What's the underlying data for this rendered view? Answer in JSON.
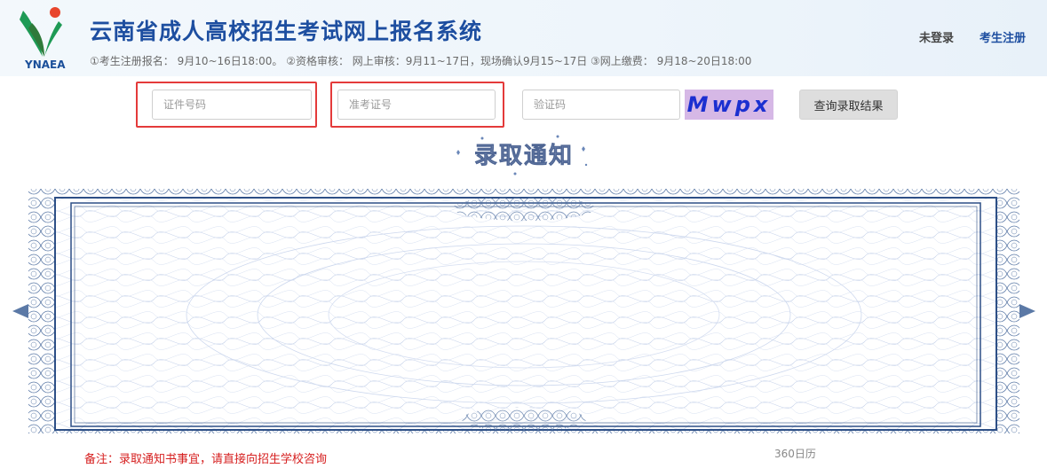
{
  "header": {
    "logo_text": "YNAEA",
    "title": "云南省成人高校招生考试网上报名系统",
    "schedule": "①考生注册报名： 9月10~16日18:00。 ②资格审核： 网上审核：9月11~17日，现场确认9月15~17日 ③网上缴费： 9月18~20日18:00",
    "login_status": "未登录",
    "register_label": "考生注册"
  },
  "search": {
    "id_placeholder": "证件号码",
    "admission_placeholder": "准考证号",
    "captcha_placeholder": "验证码",
    "captcha_text": "Mwpx",
    "query_label": "查询录取结果"
  },
  "certificate": {
    "heading": "录取通知"
  },
  "footer": {
    "note": "备注：录取通知书事宜，请直接向招生学校咨询",
    "calendar_link": "360日历"
  },
  "colors": {
    "brand_blue": "#1d4ea0",
    "highlight_red": "#e43a3a",
    "captcha_bg": "#d6b8e6",
    "captcha_text": "#1b2fd0",
    "note_red": "#d62020"
  }
}
